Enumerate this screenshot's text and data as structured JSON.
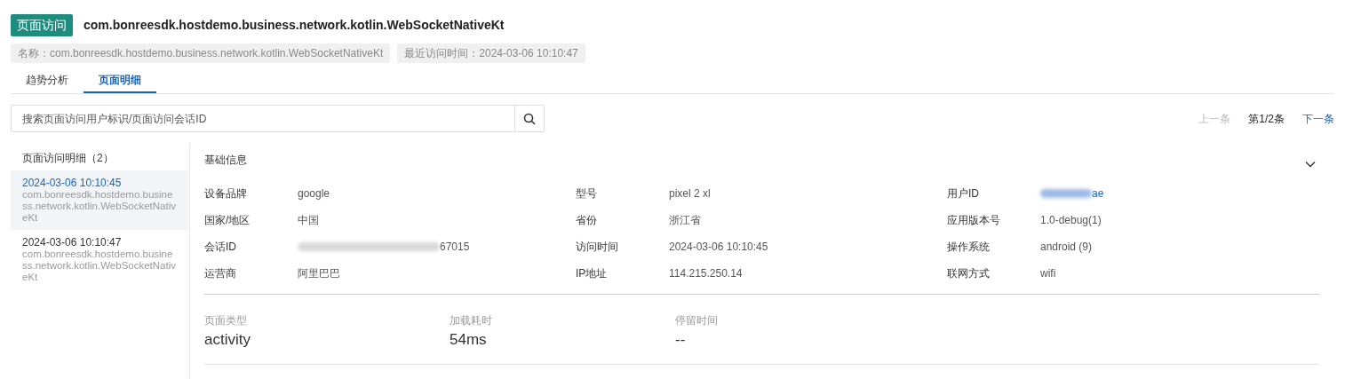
{
  "header": {
    "tag": "页面访问",
    "title": "com.bonreesdk.hostdemo.business.network.kotlin.WebSocketNativeKt"
  },
  "meta": [
    "名称：com.bonreesdk.hostdemo.business.network.kotlin.WebSocketNativeKt",
    "最近访问时间：2024-03-06 10:10:47"
  ],
  "tabs": [
    {
      "label": "趋势分析",
      "selected": false
    },
    {
      "label": "页面明细",
      "selected": true
    }
  ],
  "search": {
    "placeholder": "搜索页面访问用户标识/页面访问会话ID"
  },
  "pager": {
    "prev": {
      "label": "上一条",
      "disabled": true
    },
    "position": "第1/2条",
    "next": {
      "label": "下一条",
      "disabled": false
    }
  },
  "list": {
    "title": "页面访问明细（2）",
    "items": [
      {
        "time": "2024-03-06 10:10:45",
        "page": "com.bonreesdk.hostdemo.business.network.kotlin.WebSocketNativeKt",
        "selected": true
      },
      {
        "time": "2024-03-06 10:10:47",
        "page": "com.bonreesdk.hostdemo.business.network.kotlin.WebSocketNativeKt",
        "selected": false
      }
    ]
  },
  "detail": {
    "section_title": "基础信息",
    "expanded": true,
    "fields": [
      {
        "label": "设备品牌",
        "value": "google",
        "redacted": false,
        "link": false
      },
      {
        "label": "型号",
        "value": "pixel 2 xl",
        "redacted": false,
        "link": false
      },
      {
        "label": "用户ID",
        "value": "ae",
        "redacted": true,
        "link": true
      },
      {
        "label": "国家/地区",
        "value": "中国",
        "redacted": false,
        "link": false
      },
      {
        "label": "省份",
        "value": "浙江省",
        "redacted": false,
        "link": false
      },
      {
        "label": "应用版本号",
        "value": "1.0-debug(1)",
        "redacted": false,
        "link": false
      },
      {
        "label": "会话ID",
        "value": "67015",
        "redacted": true,
        "link": false
      },
      {
        "label": "访问时间",
        "value": "2024-03-06 10:10:45",
        "redacted": false,
        "link": false
      },
      {
        "label": "操作系统",
        "value": "android (9)",
        "redacted": false,
        "link": false
      },
      {
        "label": "运营商",
        "value": "阿里巴巴",
        "redacted": false,
        "link": false
      },
      {
        "label": "IP地址",
        "value": "114.215.250.14",
        "redacted": false,
        "link": false
      },
      {
        "label": "联网方式",
        "value": "wifi",
        "redacted": false,
        "link": false
      }
    ],
    "metrics": [
      {
        "label": "页面类型",
        "value": "activity"
      },
      {
        "label": "加载耗时",
        "value": "54ms"
      },
      {
        "label": "停留时间",
        "value": "--"
      }
    ]
  }
}
